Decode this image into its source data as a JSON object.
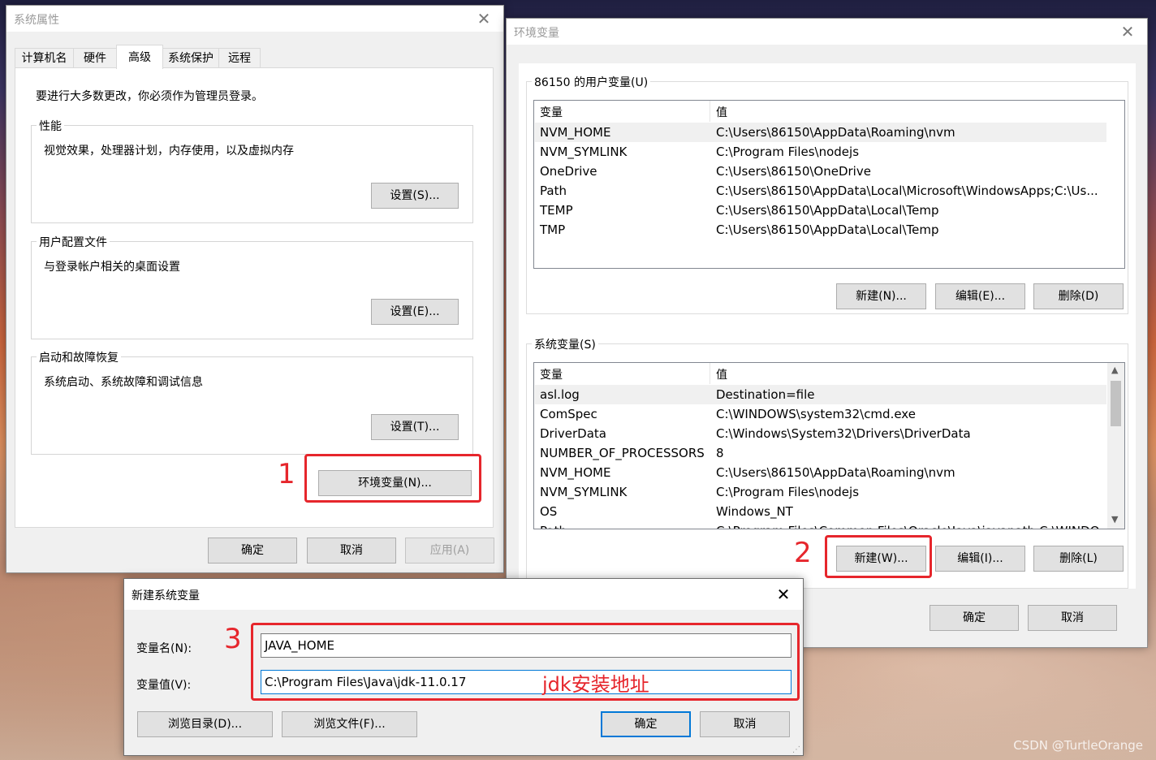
{
  "sys_props": {
    "title": "系统属性",
    "tabs": [
      "计算机名",
      "硬件",
      "高级",
      "系统保护",
      "远程"
    ],
    "admin_note": "要进行大多数更改，你必须作为管理员登录。",
    "perf": {
      "title": "性能",
      "desc": "视觉效果，处理器计划，内存使用，以及虚拟内存",
      "button": "设置(S)..."
    },
    "profile": {
      "title": "用户配置文件",
      "desc": "与登录帐户相关的桌面设置",
      "button": "设置(E)..."
    },
    "startup": {
      "title": "启动和故障恢复",
      "desc": "系统启动、系统故障和调试信息",
      "button": "设置(T)..."
    },
    "env_button": "环境变量(N)...",
    "ok": "确定",
    "cancel": "取消",
    "apply": "应用(A)"
  },
  "env": {
    "title": "环境变量",
    "user_group": "86150 的用户变量(U)",
    "col_var": "变量",
    "col_val": "值",
    "user_vars": [
      {
        "name": "NVM_HOME",
        "value": "C:\\Users\\86150\\AppData\\Roaming\\nvm"
      },
      {
        "name": "NVM_SYMLINK",
        "value": "C:\\Program Files\\nodejs"
      },
      {
        "name": "OneDrive",
        "value": "C:\\Users\\86150\\OneDrive"
      },
      {
        "name": "Path",
        "value": "C:\\Users\\86150\\AppData\\Local\\Microsoft\\WindowsApps;C:\\Us..."
      },
      {
        "name": "TEMP",
        "value": "C:\\Users\\86150\\AppData\\Local\\Temp"
      },
      {
        "name": "TMP",
        "value": "C:\\Users\\86150\\AppData\\Local\\Temp"
      }
    ],
    "user_new": "新建(N)...",
    "user_edit": "编辑(E)...",
    "user_delete": "删除(D)",
    "sys_group": "系统变量(S)",
    "sys_vars": [
      {
        "name": "asl.log",
        "value": "Destination=file"
      },
      {
        "name": "ComSpec",
        "value": "C:\\WINDOWS\\system32\\cmd.exe"
      },
      {
        "name": "DriverData",
        "value": "C:\\Windows\\System32\\Drivers\\DriverData"
      },
      {
        "name": "NUMBER_OF_PROCESSORS",
        "value": "8"
      },
      {
        "name": "NVM_HOME",
        "value": "C:\\Users\\86150\\AppData\\Roaming\\nvm"
      },
      {
        "name": "NVM_SYMLINK",
        "value": "C:\\Program Files\\nodejs"
      },
      {
        "name": "OS",
        "value": "Windows_NT"
      },
      {
        "name": "Path",
        "value": "C:\\Program Files\\Common Files\\Oracle\\Java\\javapath;C:\\WINDO..."
      }
    ],
    "sys_new": "新建(W)...",
    "sys_edit": "编辑(I)...",
    "sys_delete": "删除(L)",
    "ok": "确定",
    "cancel": "取消"
  },
  "new_var": {
    "title": "新建系统变量",
    "name_label": "变量名(N):",
    "value_label": "变量值(V):",
    "name_value": "JAVA_HOME",
    "value_value": "C:\\Program Files\\Java\\jdk-11.0.17",
    "annotation": "jdk安装地址",
    "browse_dir": "浏览目录(D)...",
    "browse_file": "浏览文件(F)...",
    "ok": "确定",
    "cancel": "取消"
  },
  "steps": [
    "1",
    "2",
    "3"
  ],
  "watermark": "CSDN @TurtleOrange",
  "colors": {
    "annotation_red": "#e6262c",
    "focus_blue": "#0078d7"
  }
}
